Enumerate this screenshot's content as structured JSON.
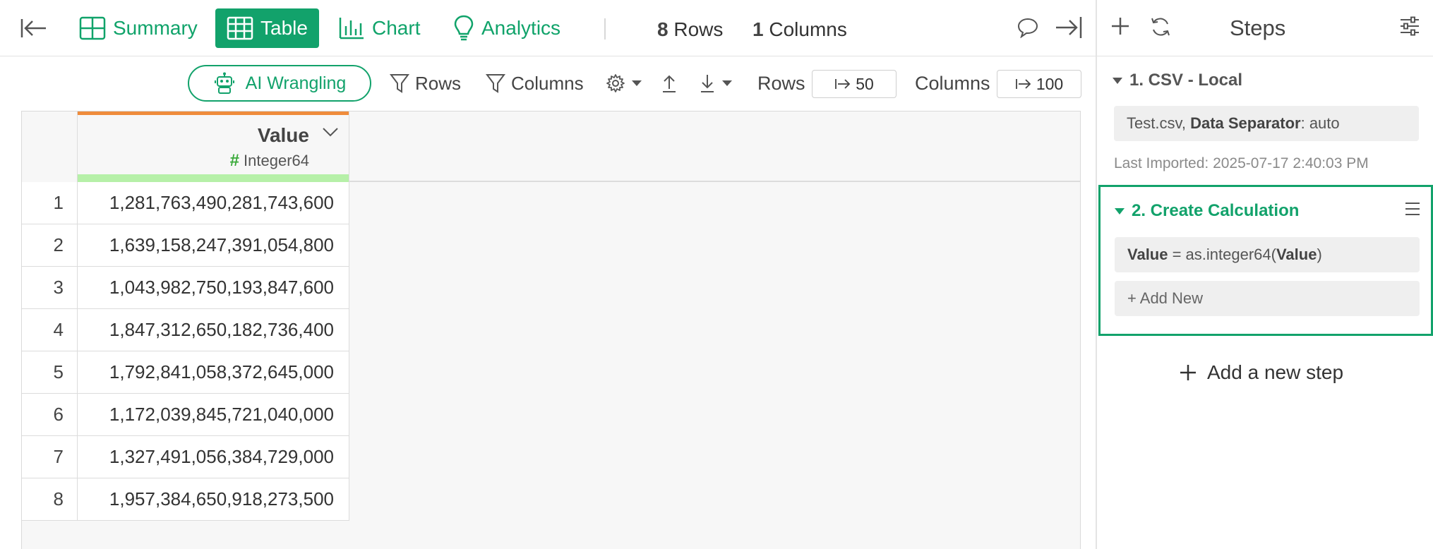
{
  "topbar": {
    "tabs": [
      {
        "label": "Summary",
        "icon": "summary-grid-icon"
      },
      {
        "label": "Table",
        "icon": "table-icon",
        "active": true
      },
      {
        "label": "Chart",
        "icon": "bar-chart-icon"
      },
      {
        "label": "Analytics",
        "icon": "lightbulb-icon"
      }
    ],
    "rows_count": "8",
    "rows_label": "Rows",
    "columns_count": "1",
    "columns_label": "Columns"
  },
  "toolbar": {
    "ai_label": "AI Wrangling",
    "filter_rows_label": "Rows",
    "filter_columns_label": "Columns",
    "rows_limit_label": "Rows",
    "rows_limit_value": "50",
    "columns_limit_label": "Columns",
    "columns_limit_value": "100"
  },
  "table": {
    "column": {
      "name": "Value",
      "type": "Integer64"
    },
    "rows": [
      {
        "n": "1",
        "value": "1,281,763,490,281,743,600"
      },
      {
        "n": "2",
        "value": "1,639,158,247,391,054,800"
      },
      {
        "n": "3",
        "value": "1,043,982,750,193,847,600"
      },
      {
        "n": "4",
        "value": "1,847,312,650,182,736,400"
      },
      {
        "n": "5",
        "value": "1,792,841,058,372,645,000"
      },
      {
        "n": "6",
        "value": "1,172,039,845,721,040,000"
      },
      {
        "n": "7",
        "value": "1,327,491,056,384,729,000"
      },
      {
        "n": "8",
        "value": "1,957,384,650,918,273,500"
      }
    ]
  },
  "steps": {
    "title": "Steps",
    "step1": {
      "title": "1. CSV - Local",
      "file": "Test.csv,",
      "separator_key": "Data Separator",
      "separator_value": ": auto",
      "last_imported": "Last Imported: 2025-07-17 2:40:03 PM"
    },
    "step2": {
      "title": "2. Create Calculation",
      "calc_target": "Value",
      "calc_op": " = as.integer64(",
      "calc_arg": "Value",
      "calc_close": ")",
      "add_new": "Add New"
    },
    "add_step": "Add a new step"
  },
  "colors": {
    "accent": "#12a26b",
    "header_top": "#ef8c3c",
    "header_bottom": "#b6f0a8"
  }
}
